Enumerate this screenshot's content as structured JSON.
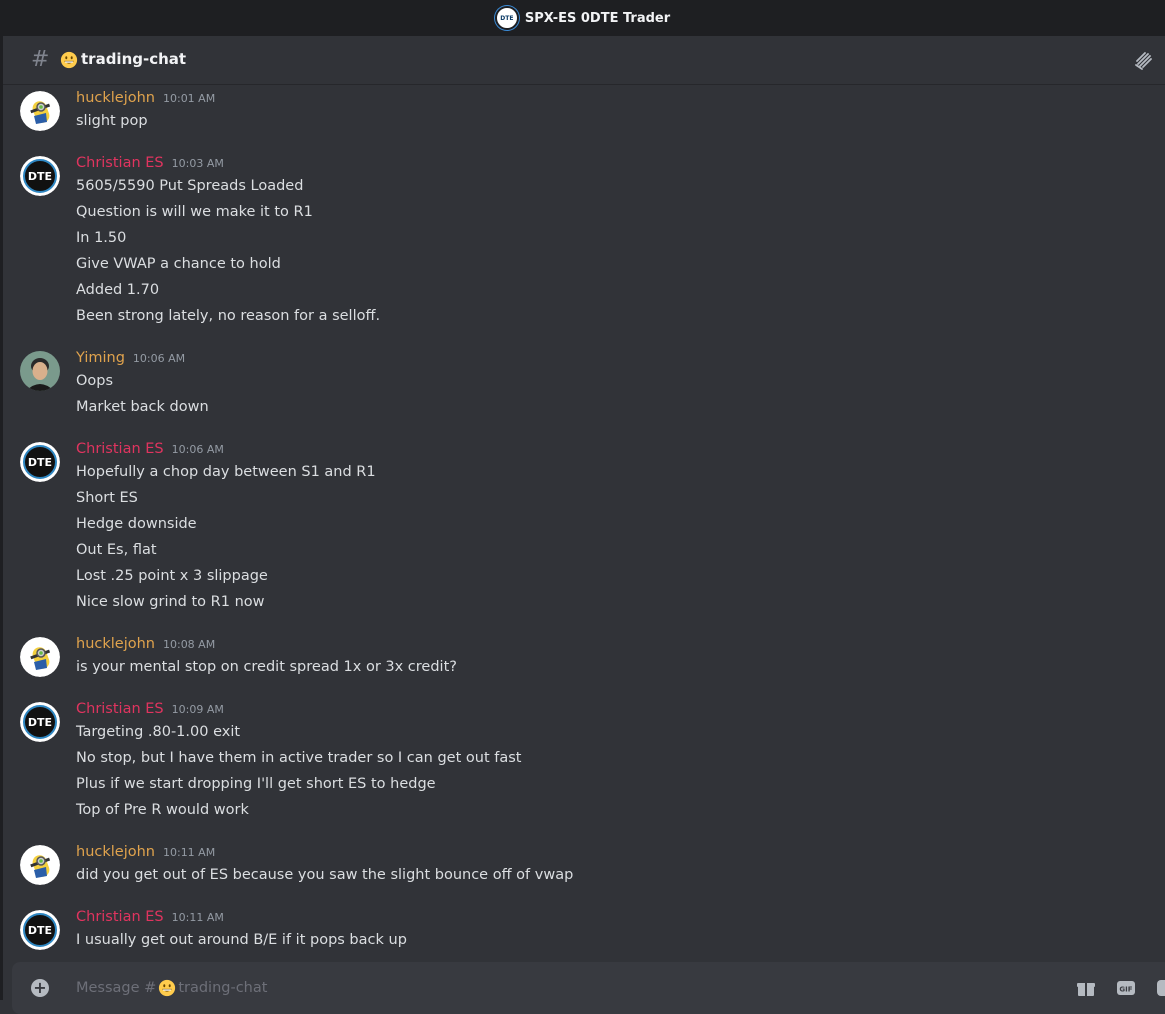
{
  "window": {
    "title": "SPX-ES 0DTE Trader",
    "logo_text": "DTE"
  },
  "channel": {
    "hash": "#",
    "name": "trading-chat"
  },
  "colors": {
    "hucklejohn": "#e0a34d",
    "christian": "#e0345f",
    "yiming": "#e0a34d"
  },
  "messages": [
    {
      "author": "hucklejohn",
      "time": "10:01 AM",
      "lines": [
        "slight pop"
      ]
    },
    {
      "author": "Christian ES",
      "time": "10:03 AM",
      "lines": [
        "5605/5590 Put Spreads Loaded",
        "Question is will we make it to R1",
        "In 1.50",
        "Give VWAP a chance to hold",
        "Added 1.70",
        "Been strong lately, no reason for a selloff."
      ]
    },
    {
      "author": "Yiming",
      "time": "10:06 AM",
      "lines": [
        "Oops",
        "Market back down"
      ]
    },
    {
      "author": "Christian ES",
      "time": "10:06 AM",
      "lines": [
        "Hopefully a chop day between S1 and R1",
        "Short ES",
        "Hedge downside",
        "Out Es, flat",
        "Lost .25 point x 3 slippage",
        "Nice slow grind to R1 now"
      ]
    },
    {
      "author": "hucklejohn",
      "time": "10:08 AM",
      "lines": [
        "is your mental stop on credit spread 1x or 3x credit?"
      ]
    },
    {
      "author": "Christian ES",
      "time": "10:09 AM",
      "lines": [
        "Targeting .80-1.00 exit",
        "No stop, but I have them in active trader so I can get out fast",
        "Plus if we start dropping I'll get short ES to hedge",
        "Top of Pre R would work"
      ]
    },
    {
      "author": "hucklejohn",
      "time": "10:11 AM",
      "lines": [
        "did you get out of ES because you saw the slight bounce off of vwap"
      ]
    },
    {
      "author": "Christian ES",
      "time": "10:11 AM",
      "lines": [
        "I usually get out around B/E if it pops back up"
      ]
    }
  ],
  "composer": {
    "placeholder_prefix": "Message #",
    "placeholder_channel": "trading-chat"
  }
}
